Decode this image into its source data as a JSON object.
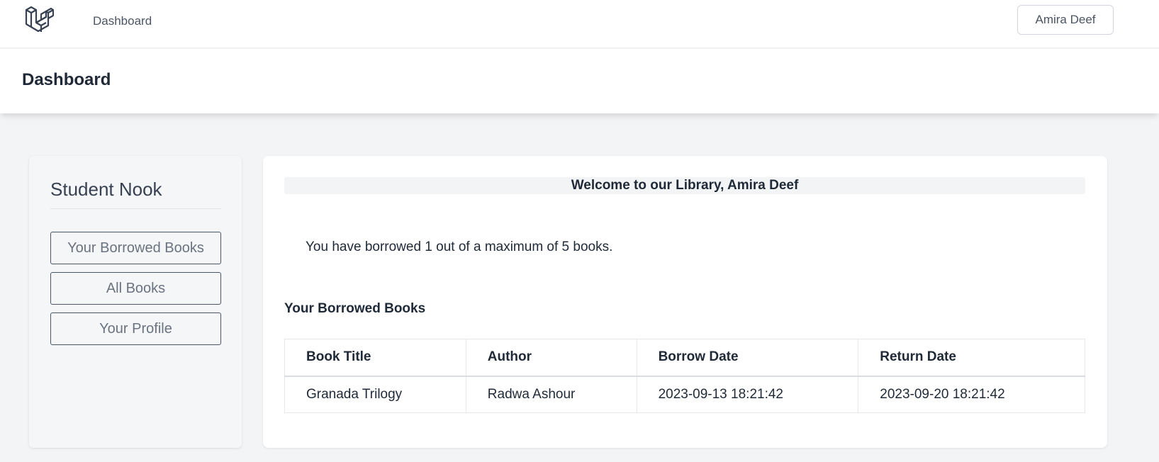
{
  "nav": {
    "logo_icon": "laravel-logo-icon",
    "dashboard_link": "Dashboard",
    "user_name": "Amira Deef"
  },
  "header": {
    "title": "Dashboard"
  },
  "sidebar": {
    "title": "Student Nook",
    "buttons": [
      {
        "label": "Your Borrowed Books"
      },
      {
        "label": "All Books"
      },
      {
        "label": "Your Profile"
      }
    ]
  },
  "main": {
    "welcome": "Welcome to our Library, Amira Deef",
    "borrow_info": "You have borrowed 1 out of a maximum of 5 books.",
    "section_title": "Your Borrowed Books",
    "table": {
      "headers": [
        "Book Title",
        "Author",
        "Borrow Date",
        "Return Date"
      ],
      "rows": [
        [
          "Granada Trilogy",
          "Radwa Ashour",
          "2023-09-13 18:21:42",
          "2023-09-20 18:21:42"
        ]
      ]
    }
  },
  "colors": {
    "logo": "#374151",
    "background": "#f3f4f6",
    "card": "#ffffff"
  }
}
